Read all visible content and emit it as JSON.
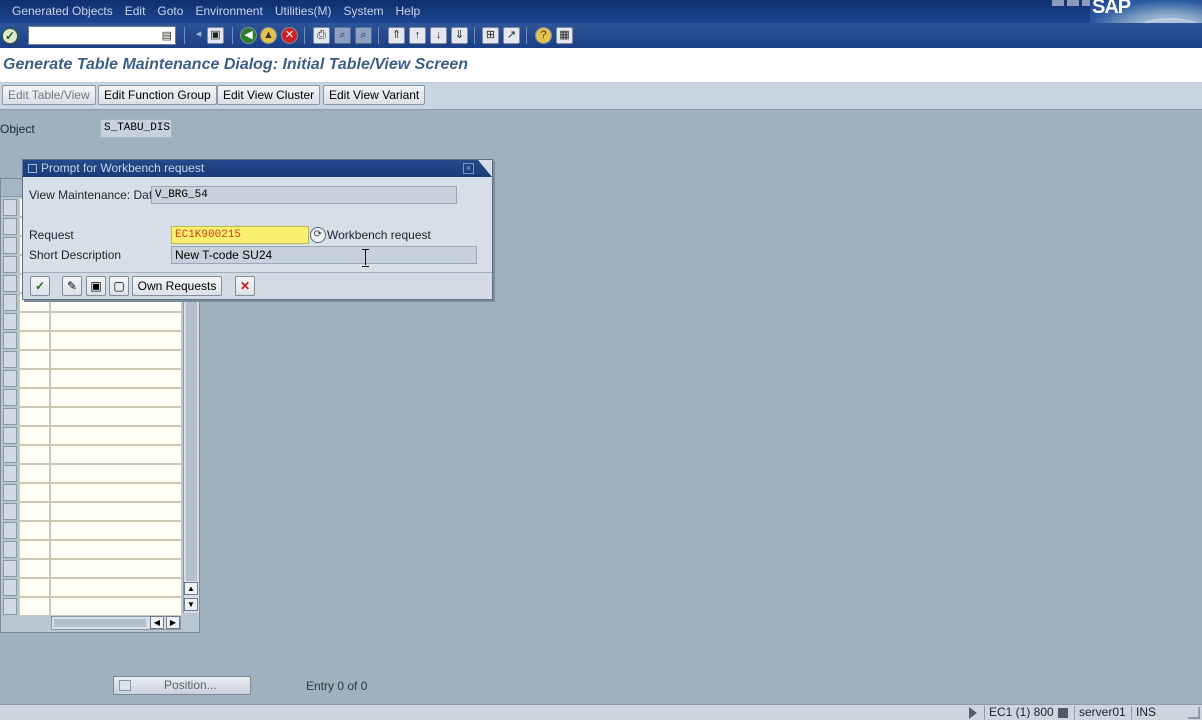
{
  "menubar": {
    "items": [
      "Generated Objects",
      "Edit",
      "Goto",
      "Environment",
      "Utilities(M)",
      "System",
      "Help"
    ],
    "logo": "SAP"
  },
  "toolbar": {
    "command_field_value": "",
    "icons": [
      "enter-icon",
      "save-icon",
      "back-icon",
      "exit-icon",
      "cancel-icon",
      "print-icon",
      "find-icon",
      "find-next-icon",
      "first-page-icon",
      "previous-page-icon",
      "next-page-icon",
      "last-page-icon",
      "create-session-icon",
      "shortcut-icon",
      "help-icon",
      "layout-icon"
    ]
  },
  "title": {
    "text": "Generate Table Maintenance Dialog: Initial Table/View Screen"
  },
  "app_toolbar": {
    "buttons": [
      "Edit Table/View",
      "Edit Function Group",
      "Edit View Cluster",
      "Edit View Variant"
    ]
  },
  "object": {
    "label": "Object",
    "value": "S_TABU_DIS"
  },
  "dialog": {
    "title": "Prompt for Workbench request",
    "view_label": "View Maintenance: Data",
    "view_value": "V_BRG_54",
    "request_label": "Request",
    "request_value": "EC1K900215",
    "request_type": "Workbench request",
    "short_desc_label": "Short Description",
    "short_desc_value": "New T-code SU24",
    "own_requests_label": "Own Requests"
  },
  "bottom": {
    "position_label": "Position...",
    "entry_text": "Entry 0 of 0"
  },
  "statusbar": {
    "system": "EC1 (1) 800",
    "server": "server01",
    "mode": "INS"
  },
  "colors": {
    "menubar": "#1d4590",
    "background": "#9fb1bd",
    "title_text": "#3c5f86",
    "request_field": "#f8f070"
  }
}
